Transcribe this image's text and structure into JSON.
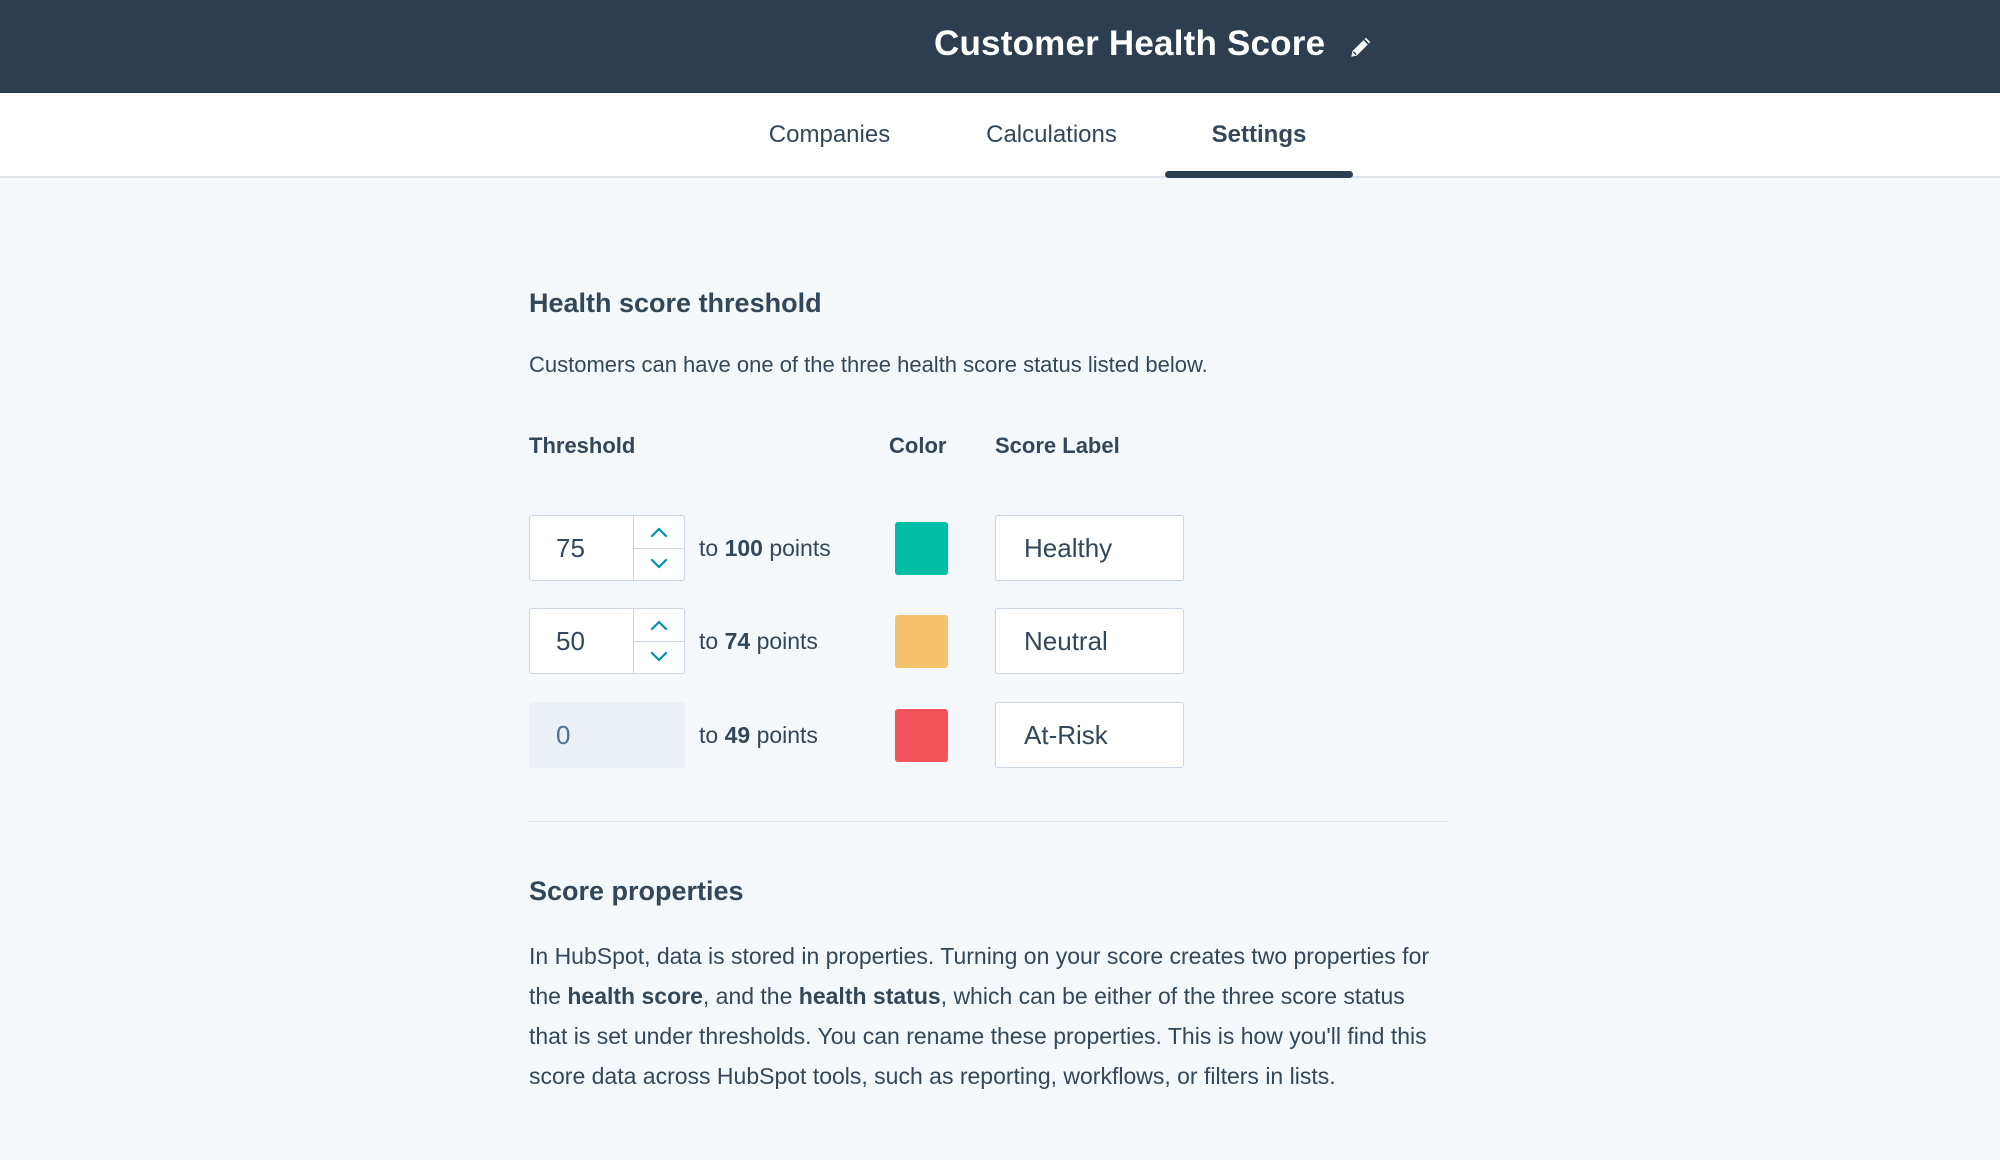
{
  "header": {
    "title": "Customer Health Score"
  },
  "tabs": [
    {
      "label": "Companies"
    },
    {
      "label": "Calculations"
    },
    {
      "label": "Settings",
      "active": true
    }
  ],
  "threshold_section": {
    "title": "Health score threshold",
    "description": "Customers can have one of the three health score status listed below.",
    "columns": {
      "threshold": "Threshold",
      "color": "Color",
      "score_label": "Score Label"
    },
    "rows": [
      {
        "min": "75",
        "to": "to",
        "max": "100",
        "unit": "points",
        "color": "#00bda5",
        "label": "Healthy"
      },
      {
        "min": "50",
        "to": "to",
        "max": "74",
        "unit": "points",
        "color": "#f5c26b",
        "label": "Neutral"
      },
      {
        "min": "0",
        "to": "to",
        "max": "49",
        "unit": "points",
        "color": "#f2545b",
        "label": "At-Risk"
      }
    ]
  },
  "properties_section": {
    "title": "Score properties",
    "text_1": "In HubSpot, data is stored in properties. Turning on your score creates two properties for the ",
    "bold_1": "health score",
    "text_2": ", and the ",
    "bold_2": "health status",
    "text_3": ", which can be either of the three score status that is set under thresholds. You can rename these properties. This is how you'll find this score data across HubSpot tools, such as reporting, workflows, or filters in lists."
  }
}
